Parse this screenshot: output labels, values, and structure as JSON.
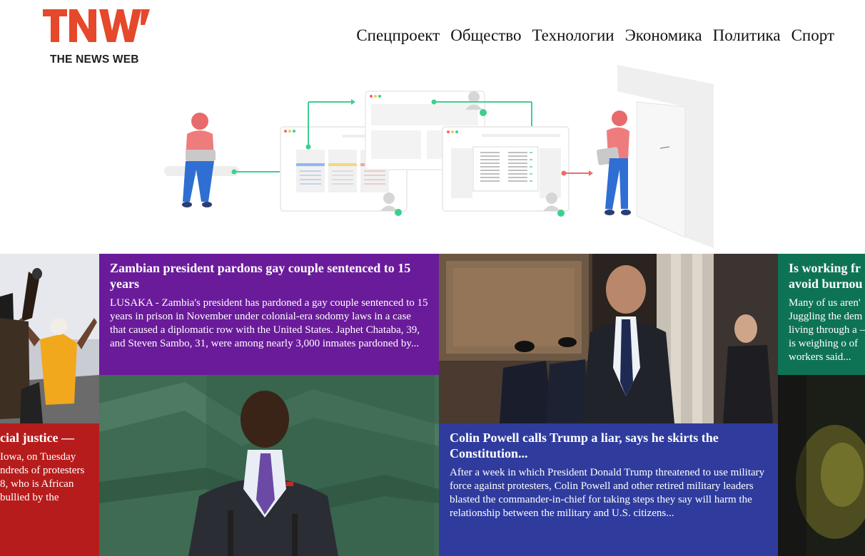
{
  "header": {
    "logo_text": "THE NEWS WEB",
    "logo_mark": "TNW",
    "nav": [
      {
        "label": "Спецпроект"
      },
      {
        "label": "Общество"
      },
      {
        "label": "Технологии"
      },
      {
        "label": "Экономика"
      },
      {
        "label": "Политика"
      },
      {
        "label": "Спорт"
      }
    ]
  },
  "colors": {
    "brand": "#e5482a",
    "purple": "#6a1b9a",
    "red": "#b71c1c",
    "blue": "#2f3c9e",
    "teal": "#0e7355",
    "accent_green": "#3ecf8e"
  },
  "articles": [
    {
      "title": "cial justice —",
      "excerpt": "Iowa, on Tuesday\nndreds of protesters\n8, who is African\nbullied by the"
    },
    {
      "title": "Zambian president pardons gay couple sentenced to 15 years",
      "excerpt": "LUSAKA - Zambia's president has pardoned a gay couple sentenced to 15 years in prison in November under colonial-era sodomy laws in a case that caused a diplomatic row with the United States. Japhet Chataba, 39, and Steven Sambo, 31, were among nearly 3,000 inmates pardoned by..."
    },
    {
      "title": "Colin Powell calls Trump a liar, says he skirts the Constitution...",
      "excerpt": "After a week in which President Donald Trump threatened to use military force against protesters, Colin Powell and other retired military leaders blasted the commander-in-chief for taking steps they say will harm the relationship between the military and U.S. citizens..."
    },
    {
      "title": "Is working fr avoid burnou",
      "excerpt": "Many of us aren' Juggling the dem living through a — is weighing o of workers said..."
    }
  ]
}
